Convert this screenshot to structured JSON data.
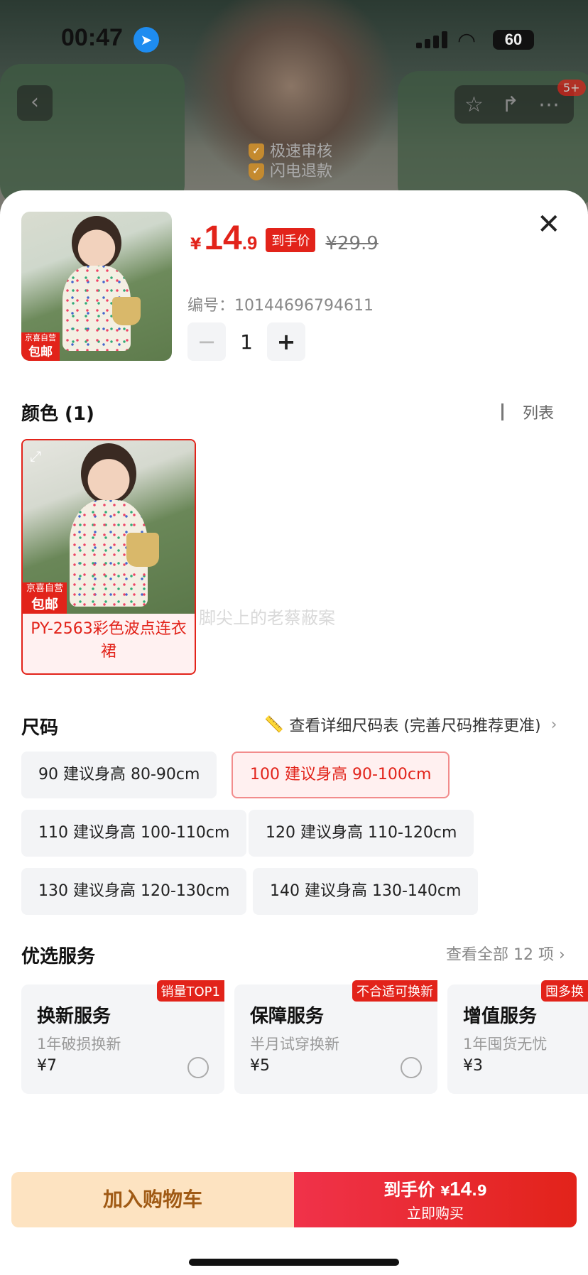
{
  "status": {
    "time": "00:47",
    "battery": "60"
  },
  "top": {
    "back": "‹",
    "badge": "5+"
  },
  "audit": {
    "line1": "极速审核",
    "line2": "闪电退款"
  },
  "product": {
    "price_symbol": "¥",
    "price_int": "14",
    "price_dec": ".9",
    "price_tag": "到手价",
    "original_price": "¥29.9",
    "sku_label": "编号：",
    "sku": "10144696794611",
    "quantity": "1",
    "jd_top": "京喜自营",
    "jd_bottom": "包邮"
  },
  "color_section": {
    "title": "颜色 (1)",
    "list_toggle": "列表",
    "option": "PY-2563彩色波点连衣裙"
  },
  "watermark": "脚尖上的老蔡蔽案",
  "size_section": {
    "title": "尺码",
    "guide": "查看详细尺码表 (完善尺码推荐更准)",
    "chips": [
      "90  建议身高 80-90cm",
      "100  建议身高 90-100cm",
      "110  建议身高 100-110cm",
      "120  建议身高 110-120cm",
      "130  建议身高 120-130cm",
      "140  建议身高 130-140cm"
    ],
    "selected": "100  建议身高 90-100cm"
  },
  "services": {
    "title": "优选服务",
    "view_all": "查看全部 12 项",
    "items": [
      {
        "ribbon": "销量TOP1",
        "name": "换新服务",
        "desc": "1年破损换新",
        "price": "¥7"
      },
      {
        "ribbon": "不合适可换新",
        "name": "保障服务",
        "desc": "半月试穿换新",
        "price": "¥5"
      },
      {
        "ribbon": "囤多换",
        "name": "增值服务",
        "desc": "1年囤货无忧",
        "price": "¥3"
      }
    ]
  },
  "cta": {
    "cart": "加入购物车",
    "buy_label": "到手价",
    "buy_symbol": "¥",
    "buy_int": "14",
    "buy_dec": ".9",
    "buy_sub": "立即购买"
  },
  "colors": {
    "accent": "#e2231a",
    "cart_bg": "#fde3c1",
    "cart_text": "#a05a14"
  }
}
